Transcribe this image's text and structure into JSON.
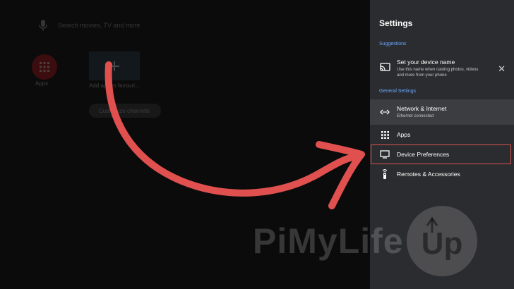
{
  "home": {
    "search_placeholder": "Search movies, TV and more",
    "apps_label": "Apps",
    "add_tile_label": "Add app to favouri...",
    "customize_label": "Customize channels"
  },
  "settings": {
    "title": "Settings",
    "suggestions_header": "Suggestions",
    "device_name": {
      "label": "Set your device name",
      "subtitle_line1": "Use this name when casting photos, videos",
      "subtitle_line2": "and more from your phone"
    },
    "general_header": "General Settings",
    "items": [
      {
        "label": "Network & Internet",
        "subtitle": "Ethernet connected",
        "icon": "network-icon"
      },
      {
        "label": "Apps",
        "icon": "apps-grid-icon"
      },
      {
        "label": "Device Preferences",
        "icon": "tv-icon"
      },
      {
        "label": "Remotes & Accessories",
        "icon": "remote-icon"
      }
    ],
    "dismiss_glyph": "✕"
  },
  "watermark": {
    "text": "PiMyLife",
    "badge_text": "Up"
  },
  "colors": {
    "panel_bg": "#2b2c2f",
    "accent_blue": "#6aa7ff",
    "highlight_red": "#d9534f",
    "arrow_red": "#e0504f"
  }
}
